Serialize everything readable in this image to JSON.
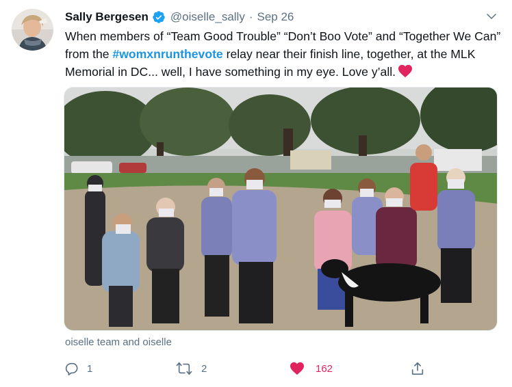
{
  "tweet": {
    "author": {
      "display_name": "Sally Bergesen",
      "handle": "@oiselle_sally",
      "verified": true,
      "verified_icon": "verified-badge-icon"
    },
    "date": "Sep 26",
    "text": {
      "part1": "When members of “Team Good Trouble” “Don’t Boo Vote” and “Together We Can” from the ",
      "hashtag": "#womxnrunthevote",
      "part2": " relay near their finish line, together, at the MLK Memorial in DC... well, I have something in my eye. Love y’all.",
      "emoji": "red-heart-icon"
    },
    "media": {
      "tagged_users": "oiselle team and oiselle"
    },
    "actions": {
      "reply": {
        "icon": "reply-icon",
        "count": "1"
      },
      "retweet": {
        "icon": "retweet-icon",
        "count": "2"
      },
      "like": {
        "icon": "heart-filled-icon",
        "count": "162",
        "liked": true
      },
      "share": {
        "icon": "share-icon"
      }
    }
  },
  "colors": {
    "link": "#1b95e0",
    "secondary_text": "#5b7083",
    "like": "#e0245e",
    "verified": "#1da1f2"
  }
}
